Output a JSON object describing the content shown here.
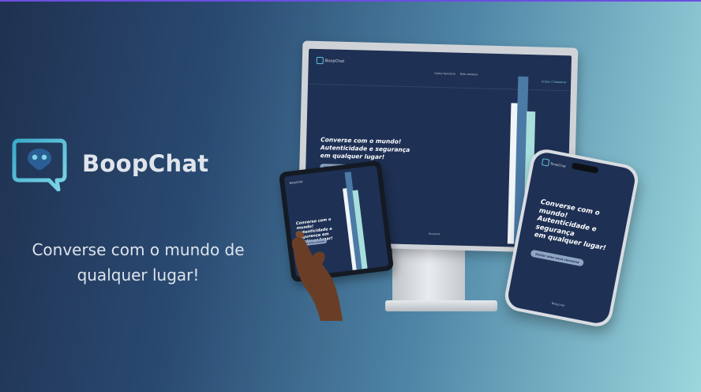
{
  "brand": {
    "name": "BoopChat",
    "tagline_line1": "Converse com o mundo de",
    "tagline_line2": "qualquer lugar!",
    "colors": {
      "accent": "#5ec0d8",
      "mascot": "#2a5f95",
      "screen_bg": "#1e3154"
    }
  },
  "devices": {
    "monitor": {
      "logo": "BoopChat",
      "nav": [
        "Como funciona",
        "Fale conosco"
      ],
      "link": "Entrar / Cadastrar",
      "hero_line1": "Converse com o mundo!",
      "hero_line2": "Autenticidade e segurança",
      "hero_line3": "em qualquer lugar!",
      "button": "Iniciar uma conversa",
      "footer": "Boopchat"
    },
    "tablet": {
      "logo": "BoopChat",
      "hero": "Converse com o mundo! Autenticidade e segurança em qualquer lugar!",
      "button": "Iniciar uma conversa"
    },
    "phone": {
      "logo": "BoopChat",
      "hero_line1": "Converse com o",
      "hero_line2": "mundo!",
      "hero_line3": "Autenticidade e",
      "hero_line4": "segurança",
      "hero_line5": "em qualquer lugar!",
      "button": "Iniciar uma nova conversa",
      "footer": "Boopchat"
    }
  }
}
